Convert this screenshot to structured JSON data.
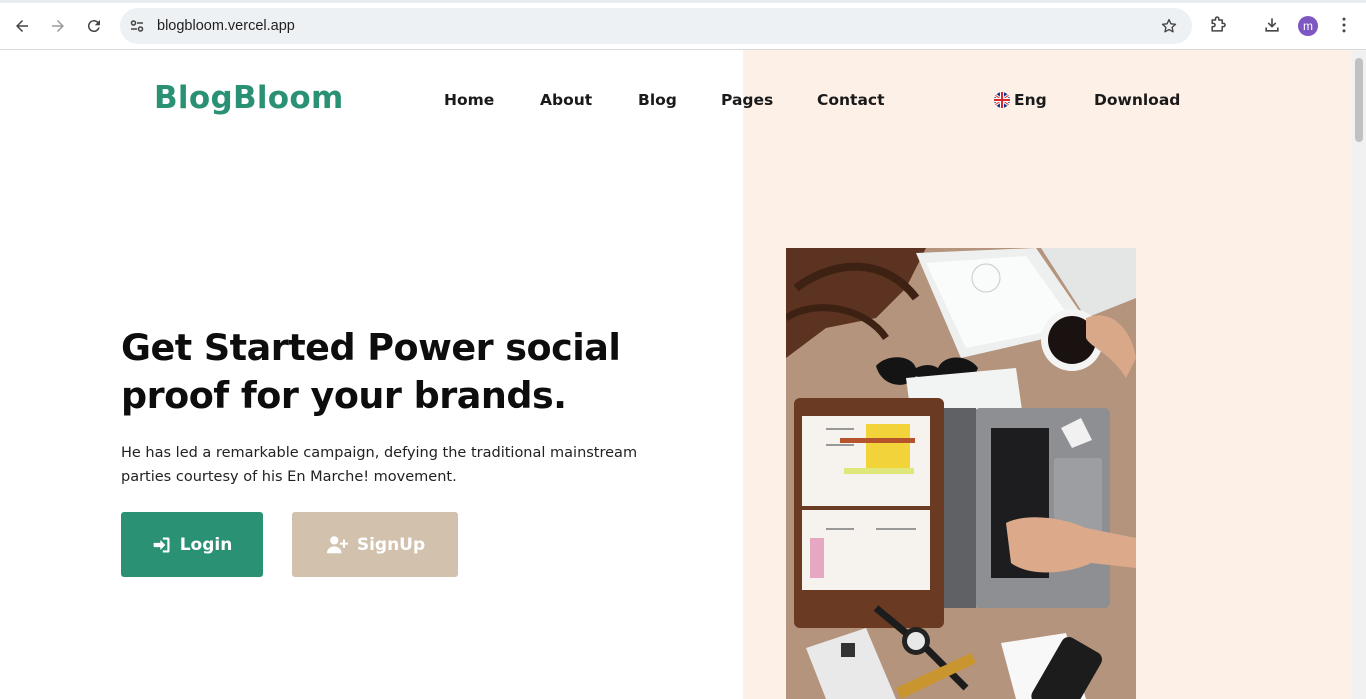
{
  "browser": {
    "url": "blogbloom.vercel.app",
    "profile_initial": "m",
    "icons": {
      "back": "arrow-left-icon",
      "forward": "arrow-right-icon",
      "reload": "reload-icon",
      "site_info": "tune-icon",
      "bookmark": "star-icon",
      "extensions": "puzzle-icon",
      "downloads": "download-icon",
      "menu": "kebab-menu-icon"
    }
  },
  "site": {
    "brand": "BlogBloom",
    "brand_color": "#2a9175",
    "nav": [
      "Home",
      "About",
      "Blog",
      "Pages",
      "Contact"
    ],
    "language": "Eng",
    "download_label": "Download"
  },
  "hero": {
    "title": "Get Started Power social proof for your brands.",
    "subtitle": "He has led a remarkable campaign, defying the traditional mainstream parties courtesy of his En Marche! movement.",
    "login_label": "Login",
    "signup_label": "SignUp",
    "login_color": "#2a9175",
    "signup_color": "#d2c1ad",
    "panel_color": "#fdf0e6"
  }
}
